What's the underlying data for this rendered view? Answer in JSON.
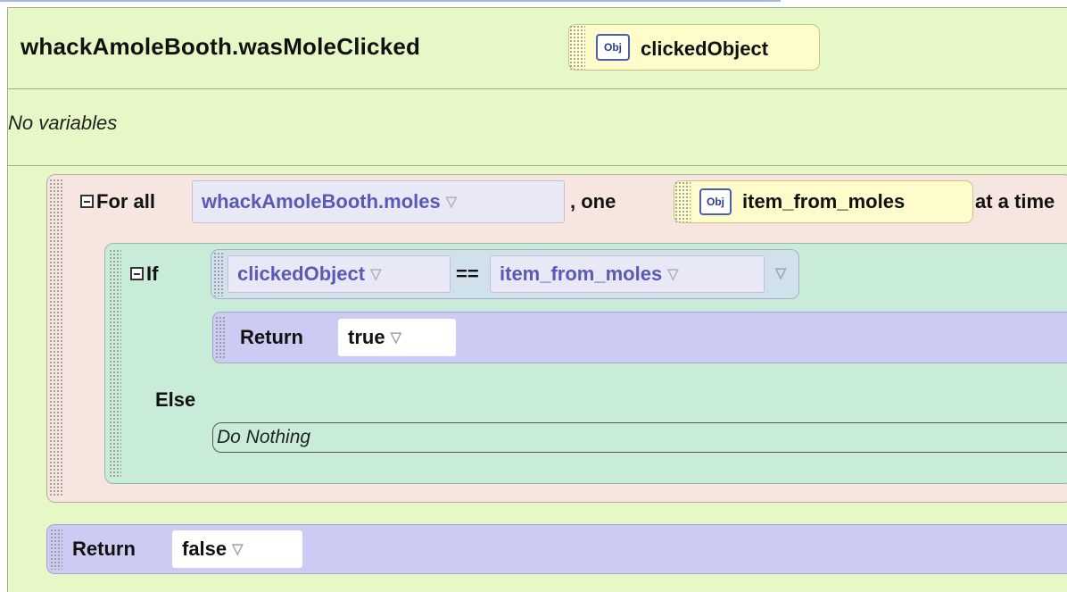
{
  "method": {
    "name": "whackAmoleBooth.wasMoleClicked",
    "param_type_icon": "Obj",
    "param_name": "clickedObject"
  },
  "variables_text": "No variables",
  "forall": {
    "label": "For all",
    "collection": "whackAmoleBooth.moles",
    "separator": ", one",
    "item_type_icon": "Obj",
    "item_name": "item_from_moles",
    "suffix": "at a time"
  },
  "if_block": {
    "label": "If",
    "left_operand": "clickedObject",
    "operator": "==",
    "right_operand": "item_from_moles",
    "then_return_label": "Return",
    "then_return_value": "true",
    "else_label": "Else",
    "else_body": "Do Nothing"
  },
  "final_return": {
    "label": "Return",
    "value": "false"
  },
  "icons": {
    "collapse": "minus-box-icon",
    "dropdown": "triangle-down-icon",
    "drag": "drag-grip-icon",
    "object_type": "obj-type-icon"
  },
  "colors": {
    "method_bg": "#e6f8c6",
    "param_bg": "#fffccb",
    "forall_bg": "#f6e6df",
    "if_bg": "#c8ecd8",
    "condition_bg": "#d0e1ec",
    "return_bg": "#cccbf3",
    "identifier_text": "#5a5ab4"
  }
}
